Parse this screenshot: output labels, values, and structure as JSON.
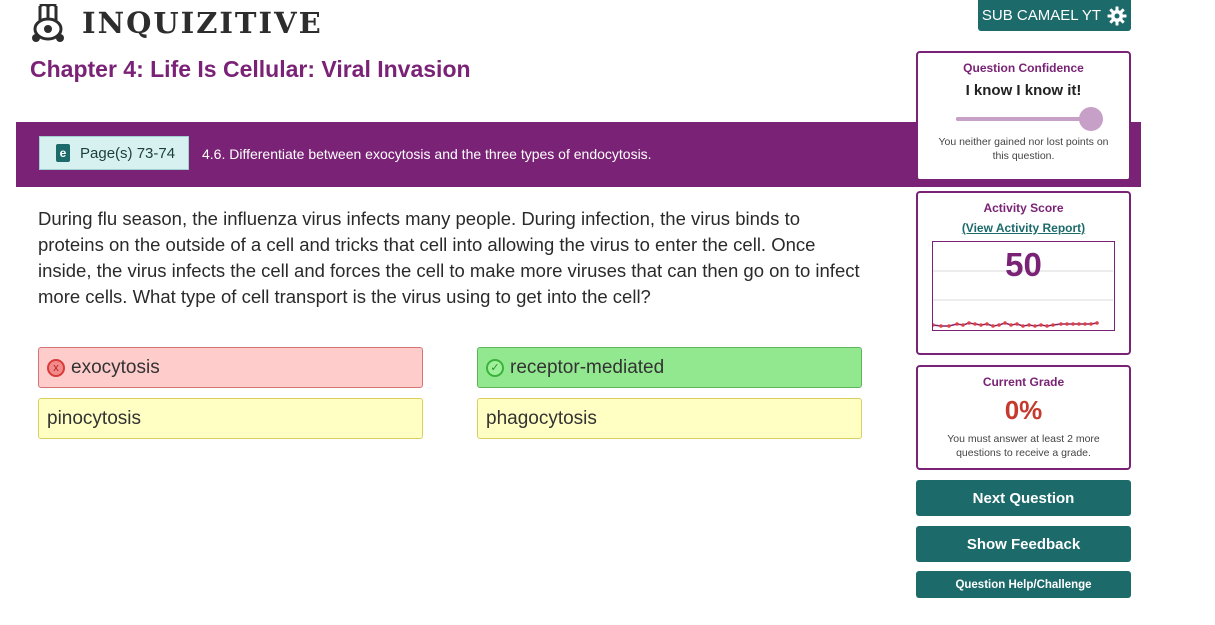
{
  "logo": {
    "text": "INQUIZITIVE",
    "icon": "bunny-icon"
  },
  "user": {
    "name": "SUB CAMAEL YT",
    "icon": "gear-icon"
  },
  "chapter_title": "Chapter 4: Life Is Cellular: Viral Invasion",
  "learning_objective": {
    "pages_label": "Page(s) 73-74",
    "book_icon_letter": "e",
    "text": "4.6. Differentiate between exocytosis and the three types of endocytosis."
  },
  "question": "During flu season, the influenza virus infects many people. During infection, the virus binds to proteins on the outside of a cell and tricks that cell into allowing the virus to enter the cell. Once inside, the virus infects the cell and forces the cell to make more viruses that can then go on to infect more cells. What type of cell transport is the virus using to get into the cell?",
  "answers": [
    {
      "label": "exocytosis",
      "status": "incorrect",
      "mark": "x"
    },
    {
      "label": "receptor-mediated",
      "status": "correct",
      "mark": "✓"
    },
    {
      "label": "pinocytosis",
      "status": "unselected"
    },
    {
      "label": "phagocytosis",
      "status": "unselected"
    }
  ],
  "confidence": {
    "heading": "Question Confidence",
    "level": "I know I know it!",
    "slider_fraction": 1.0,
    "note": "You neither gained nor lost points on this question."
  },
  "activity_score": {
    "heading": "Activity Score",
    "link": "(View Activity Report)",
    "value": "50"
  },
  "grade": {
    "heading": "Current Grade",
    "value": "0%",
    "note": "You must answer at least 2 more questions to receive a grade."
  },
  "actions": {
    "next": "Next Question",
    "feedback": "Show Feedback",
    "help": "Question Help/Challenge"
  },
  "colors": {
    "brand_purple": "#7a2376",
    "teal": "#1d6a6b",
    "grade_red": "#c43b2e"
  }
}
